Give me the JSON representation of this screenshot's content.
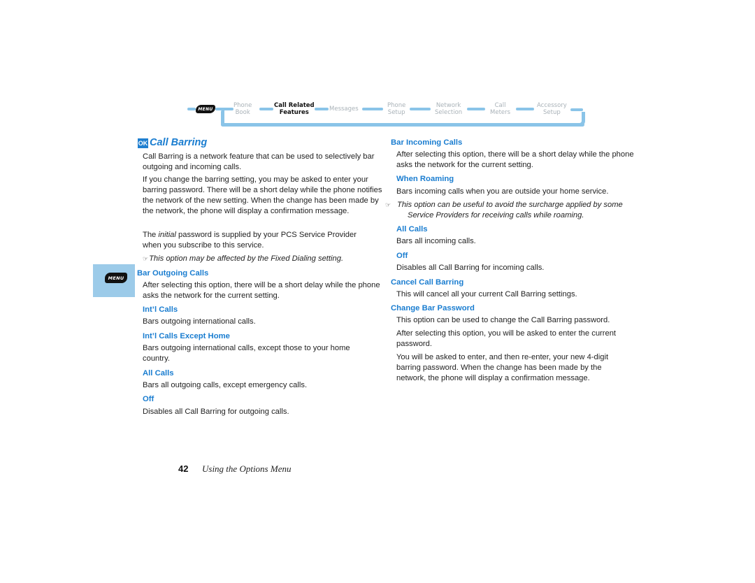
{
  "nav": {
    "menu_key": "MENU",
    "items": [
      {
        "line1": "Phone",
        "line2": "Book",
        "active": false
      },
      {
        "line1": "Call Related",
        "line2": "Features",
        "active": true
      },
      {
        "line1": "Messages",
        "line2": "",
        "active": false
      },
      {
        "line1": "Phone",
        "line2": "Setup",
        "active": false
      },
      {
        "line1": "Network",
        "line2": "Selection",
        "active": false
      },
      {
        "line1": "Call",
        "line2": "Meters",
        "active": false
      },
      {
        "line1": "Accessory",
        "line2": "Setup",
        "active": false
      }
    ],
    "accent_color": "#8ac4e8"
  },
  "section": {
    "ok_badge": "OK",
    "title": "Call Barring",
    "title_color": "#1a7dd0"
  },
  "left": {
    "intro1": "Call Barring is a network feature that can be used to selectively bar outgoing and incoming calls.",
    "intro2": "If you change the barring setting, you may be asked to enter your barring password. There will be a short delay while the phone notifies the network of the new setting. When the change has been made by the network, the phone will display a confirmation message.",
    "intro3_pre": "The ",
    "intro3_em": "initial",
    "intro3_post": " password is supplied by your PCS Service Provider when you subscribe to this service.",
    "note_icon": "☞",
    "note": "This option may be affected by the Fixed Dialing setting.",
    "menu_tab_key": "MENU",
    "bar_outgoing": {
      "heading": "Bar Outgoing Calls",
      "text": "After selecting this option, there will be a short delay while the phone asks the network for the current setting."
    },
    "options": [
      {
        "heading": "Int’l Calls",
        "text": "Bars outgoing international calls."
      },
      {
        "heading": "Int’l Calls Except Home",
        "text": "Bars outgoing international calls, except those to your home country."
      },
      {
        "heading": "All Calls",
        "text": "Bars all outgoing calls, except emergency calls."
      },
      {
        "heading": "Off",
        "text": "Disables all Call Barring for outgoing calls."
      }
    ]
  },
  "right": {
    "bar_incoming": {
      "heading": "Bar Incoming Calls",
      "text": "After selecting this option, there will be a short delay while the phone asks the network for the current setting."
    },
    "when_roaming": {
      "heading": "When Roaming",
      "text": "Bars incoming calls when you are outside your home service.",
      "note_icon": "☞",
      "note": "This option can be useful to avoid the surcharge applied by some Service Providers for receiving calls while roaming."
    },
    "all_calls": {
      "heading": "All Calls",
      "text": "Bars all incoming calls."
    },
    "off": {
      "heading": "Off",
      "text": "Disables all Call Barring for incoming calls."
    },
    "cancel": {
      "heading": "Cancel Call Barring",
      "text": "This will cancel all your current Call Barring settings."
    },
    "change_password": {
      "heading": "Change Bar Password",
      "text1": "This option can be used to change the Call Barring password.",
      "text2": "After selecting this option, you will be asked to enter the current password.",
      "text3": "You will be asked to enter, and then re-enter, your new 4-digit barring password. When the change has been made by the network, the phone will display a confirmation message."
    }
  },
  "footer": {
    "page_number": "42",
    "chapter": "Using the Options Menu"
  }
}
